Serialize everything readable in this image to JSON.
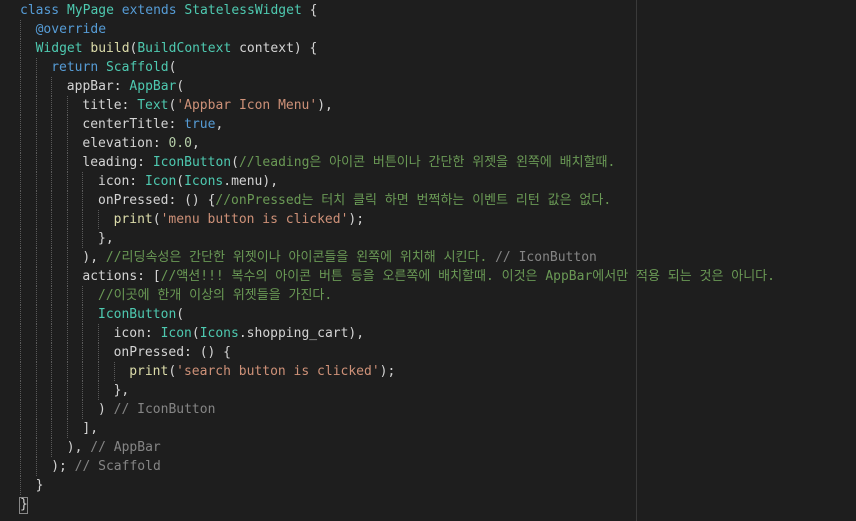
{
  "editor": {
    "theme": "dark",
    "background": "#1e1e1e",
    "colors": {
      "keyword": "#569cd6",
      "type": "#4ec9b0",
      "function": "#dcdcaa",
      "string": "#ce9178",
      "comment": "#6a9955",
      "number": "#b5cea8"
    },
    "lines": [
      {
        "indent": 0,
        "tokens": [
          [
            "kw",
            "class "
          ],
          [
            "type",
            "MyPage "
          ],
          [
            "kw",
            "extends "
          ],
          [
            "type",
            "StatelessWidget "
          ],
          [
            "brace",
            "{"
          ]
        ]
      },
      {
        "indent": 1,
        "tokens": [
          [
            "ann",
            "@override"
          ]
        ]
      },
      {
        "indent": 1,
        "tokens": [
          [
            "type",
            "Widget "
          ],
          [
            "fn",
            "build"
          ],
          [
            "punc",
            "("
          ],
          [
            "type",
            "BuildContext "
          ],
          [
            "prop",
            "context"
          ],
          [
            "punc",
            ") {"
          ]
        ]
      },
      {
        "indent": 2,
        "tokens": [
          [
            "kw",
            "return "
          ],
          [
            "type",
            "Scaffold"
          ],
          [
            "punc",
            "("
          ]
        ]
      },
      {
        "indent": 3,
        "tokens": [
          [
            "prop",
            "appBar: "
          ],
          [
            "type",
            "AppBar"
          ],
          [
            "punc",
            "("
          ]
        ]
      },
      {
        "indent": 4,
        "tokens": [
          [
            "prop",
            "title: "
          ],
          [
            "type",
            "Text"
          ],
          [
            "punc",
            "("
          ],
          [
            "str",
            "'Appbar Icon Menu'"
          ],
          [
            "punc",
            "),"
          ]
        ]
      },
      {
        "indent": 4,
        "tokens": [
          [
            "prop",
            "centerTitle: "
          ],
          [
            "kw",
            "true"
          ],
          [
            "punc",
            ","
          ]
        ]
      },
      {
        "indent": 4,
        "tokens": [
          [
            "prop",
            "elevation: "
          ],
          [
            "num",
            "0.0"
          ],
          [
            "punc",
            ","
          ]
        ]
      },
      {
        "indent": 4,
        "tokens": [
          [
            "prop",
            "leading: "
          ],
          [
            "type",
            "IconButton"
          ],
          [
            "punc",
            "("
          ],
          [
            "cmt",
            "//leading은 아이콘 버튼이나 간단한 위젯을 왼쪽에 배치할때."
          ]
        ]
      },
      {
        "indent": 5,
        "tokens": [
          [
            "prop",
            "icon: "
          ],
          [
            "type",
            "Icon"
          ],
          [
            "punc",
            "("
          ],
          [
            "type",
            "Icons"
          ],
          [
            "punc",
            "."
          ],
          [
            "prop",
            "menu"
          ],
          [
            "punc",
            "),"
          ]
        ]
      },
      {
        "indent": 5,
        "tokens": [
          [
            "prop",
            "onPressed: "
          ],
          [
            "punc",
            "() {"
          ],
          [
            "cmt",
            "//onPressed는 터치 클릭 하면 번쩍하는 이벤트 리턴 값은 없다."
          ]
        ]
      },
      {
        "indent": 6,
        "tokens": [
          [
            "fn",
            "print"
          ],
          [
            "punc",
            "("
          ],
          [
            "str",
            "'menu button is clicked'"
          ],
          [
            "punc",
            ");"
          ]
        ]
      },
      {
        "indent": 5,
        "tokens": [
          [
            "punc",
            "},"
          ]
        ]
      },
      {
        "indent": 4,
        "tokens": [
          [
            "punc",
            "), "
          ],
          [
            "cmt",
            "//리딩속성은 간단한 위젯이나 아이콘들을 왼쪽에 위치해 시킨다. "
          ],
          [
            "cmtg",
            "// IconButton"
          ]
        ]
      },
      {
        "indent": 4,
        "tokens": [
          [
            "prop",
            "actions: "
          ],
          [
            "punc",
            "["
          ],
          [
            "cmt",
            "//액션!!! 복수의 아이콘 버튼 등을 오른쪽에 배치할때. 이것은 AppBar에서만 적용 되는 것은 아니다."
          ]
        ]
      },
      {
        "indent": 5,
        "tokens": [
          [
            "cmt",
            "//이곳에 한개 이상의 위젯들을 가진다."
          ]
        ]
      },
      {
        "indent": 5,
        "tokens": [
          [
            "type",
            "IconButton"
          ],
          [
            "punc",
            "("
          ]
        ]
      },
      {
        "indent": 6,
        "tokens": [
          [
            "prop",
            "icon: "
          ],
          [
            "type",
            "Icon"
          ],
          [
            "punc",
            "("
          ],
          [
            "type",
            "Icons"
          ],
          [
            "punc",
            "."
          ],
          [
            "prop",
            "shopping_cart"
          ],
          [
            "punc",
            "),"
          ]
        ]
      },
      {
        "indent": 6,
        "tokens": [
          [
            "prop",
            "onPressed: "
          ],
          [
            "punc",
            "() {"
          ]
        ]
      },
      {
        "indent": 7,
        "tokens": [
          [
            "fn",
            "print"
          ],
          [
            "punc",
            "("
          ],
          [
            "str",
            "'search button is clicked'"
          ],
          [
            "punc",
            ");"
          ]
        ]
      },
      {
        "indent": 6,
        "tokens": [
          [
            "punc",
            "},"
          ]
        ]
      },
      {
        "indent": 5,
        "tokens": [
          [
            "punc",
            ") "
          ],
          [
            "cmtg",
            "// IconButton"
          ]
        ]
      },
      {
        "indent": 4,
        "tokens": [
          [
            "punc",
            "],"
          ]
        ]
      },
      {
        "indent": 3,
        "tokens": [
          [
            "punc",
            "), "
          ],
          [
            "cmtg",
            "// AppBar"
          ]
        ]
      },
      {
        "indent": 2,
        "tokens": [
          [
            "punc",
            "); "
          ],
          [
            "cmtg",
            "// Scaffold"
          ]
        ]
      },
      {
        "indent": 1,
        "tokens": [
          [
            "punc",
            "}"
          ]
        ]
      },
      {
        "indent": 0,
        "tokens": [
          [
            "brace",
            "}"
          ]
        ]
      }
    ]
  }
}
